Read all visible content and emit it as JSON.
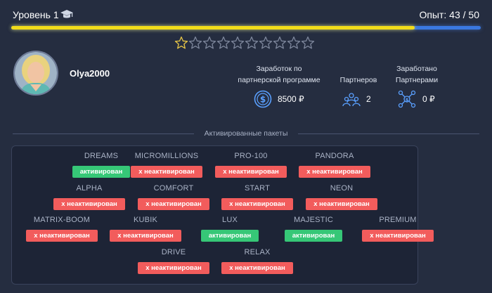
{
  "header": {
    "level_label": "Уровень 1",
    "xp_label": "Опыт: 43 / 50",
    "xp_progress": 0.86,
    "colors": {
      "xp_fill": "#f2dc1a",
      "xp_track": "#3a78e0"
    }
  },
  "rating": {
    "filled": 1,
    "total": 10
  },
  "profile": {
    "username": "Olya2000"
  },
  "stats": {
    "earnings": {
      "label": "Заработок по партнерской программе",
      "value": "8500 ₽",
      "icon": "dollar-coin-icon"
    },
    "partners": {
      "label": "Партнеров",
      "value": "2",
      "icon": "team-icon"
    },
    "earned": {
      "label": "Заработано Партнерами",
      "value": "0 ₽",
      "icon": "network-icon"
    }
  },
  "packages": {
    "title": "Активированные пакеты",
    "colors": {
      "active": "#36c777",
      "inactive": "#f25c5c"
    },
    "items": [
      {
        "name": "DREAMS",
        "status": "активирован",
        "active": true
      },
      {
        "name": "MICROMILLIONS",
        "status": "x неактивирован",
        "active": false
      },
      {
        "name": "PRO-100",
        "status": "x неактивирован",
        "active": false
      },
      {
        "name": "PANDORA",
        "status": "x неактивирован",
        "active": false
      },
      {
        "name": "ALPHA",
        "status": "x неактивирован",
        "active": false
      },
      {
        "name": "COMFORT",
        "status": "x неактивирован",
        "active": false
      },
      {
        "name": "START",
        "status": "x неактивирован",
        "active": false
      },
      {
        "name": "NEON",
        "status": "x неактивирован",
        "active": false
      },
      {
        "name": "MATRIX-BOOM",
        "status": "x неактивирован",
        "active": false
      },
      {
        "name": "KUBIK",
        "status": "x неактивирован",
        "active": false
      },
      {
        "name": "LUX",
        "status": "активирован",
        "active": true
      },
      {
        "name": "MAJESTIC",
        "status": "активирован",
        "active": true
      },
      {
        "name": "PREMIUM",
        "status": "x неактивирован",
        "active": false
      },
      {
        "name": "DRIVE",
        "status": "x неактивирован",
        "active": false
      },
      {
        "name": "RELAX",
        "status": "x неактивирован",
        "active": false
      }
    ]
  }
}
